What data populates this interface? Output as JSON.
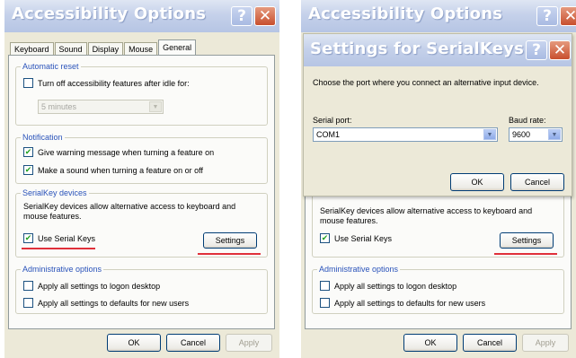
{
  "left": {
    "title": "Accessibility Options",
    "help_glyph": "?",
    "close_glyph": "✕",
    "tabs": [
      "Keyboard",
      "Sound",
      "Display",
      "Mouse",
      "General"
    ],
    "active_tab": "General",
    "automatic_reset": {
      "title": "Automatic reset",
      "turn_off_label": "Turn off accessibility features after idle for:",
      "turn_off_checked": false,
      "idle_value": "5 minutes"
    },
    "notification": {
      "title": "Notification",
      "warning_label": "Give warning message when turning a feature on",
      "warning_checked": true,
      "sound_label": "Make a sound when turning a feature on or off",
      "sound_checked": true
    },
    "serialkey": {
      "title": "SerialKey devices",
      "description": "SerialKey devices allow alternative access to keyboard and mouse features.",
      "use_label": "Use Serial Keys",
      "use_checked": true,
      "settings_label": "Settings"
    },
    "admin": {
      "title": "Administrative options",
      "logon_label": "Apply all settings to logon desktop",
      "defaults_label": "Apply all settings to defaults for new users"
    },
    "buttons": {
      "ok": "OK",
      "cancel": "Cancel",
      "apply": "Apply"
    }
  },
  "right": {
    "title": "Accessibility Options",
    "help_glyph": "?",
    "close_glyph": "✕",
    "dialog": {
      "title": "Settings for SerialKeys",
      "help_glyph": "?",
      "close_glyph": "✕",
      "instruction": "Choose the port where you connect an alternative input device.",
      "serial_port_label": "Serial port:",
      "serial_port_value": "COM1",
      "baud_rate_label": "Baud rate:",
      "baud_rate_value": "9600",
      "ok": "OK",
      "cancel": "Cancel"
    },
    "serialkey": {
      "description": "SerialKey devices allow alternative access to keyboard and mouse features.",
      "use_label": "Use Serial Keys",
      "use_checked": true,
      "settings_label": "Settings"
    },
    "admin": {
      "title": "Administrative options",
      "logon_label": "Apply all settings to logon desktop",
      "defaults_label": "Apply all settings to defaults for new users"
    },
    "buttons": {
      "ok": "OK",
      "cancel": "Cancel",
      "apply": "Apply"
    }
  },
  "colors": {
    "highlight_underline": "#e0303a",
    "group_title": "#2a53ba",
    "checkmark": "#21a121"
  }
}
